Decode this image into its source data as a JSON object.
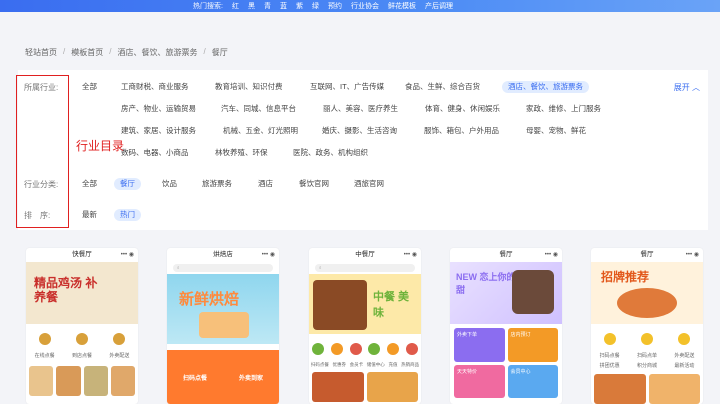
{
  "topbar": {
    "hot_label": "热门搜索:",
    "keywords": [
      "红",
      "黑",
      "青",
      "蓝",
      "紫",
      "绿",
      "预约",
      "行业协会",
      "鲜花模板",
      "产后调理"
    ]
  },
  "breadcrumb": [
    "轻站首页",
    "模板首页",
    "酒店、餐饮、旅游票务",
    "餐厅"
  ],
  "filters": {
    "industry_label": "所属行业:",
    "industry_options": [
      "全部",
      "工商财税、商业服务",
      "教育培训、知识付费",
      "互联网、IT、广告传媒",
      "食品、生鲜、综合百货",
      "酒店、餐饮、旅游票务",
      "房产、物业、运输贸易",
      "汽车、同城、信息平台",
      "丽人、美容、医疗养生",
      "体育、健身、休闲娱乐",
      "家政、维修、上门服务",
      "建筑、家居、设计服务",
      "机械、五金、灯光照明",
      "婚庆、摄影、生活咨询",
      "服饰、箱包、户外用品",
      "母婴、宠物、鲜花",
      "数码、电器、小商品",
      "林牧养殖、环保",
      "医院、政务、机构组织"
    ],
    "expand_label": "展开 ︿",
    "category_label": "行业分类:",
    "category_options": [
      "全部",
      "餐厅",
      "饮品",
      "旅游票务",
      "酒店",
      "餐饮官网",
      "酒旅官网"
    ],
    "sort_label": "排　序:",
    "sort_options": [
      "最新",
      "热门"
    ]
  },
  "annotation": {
    "text": "行业目录",
    "color": "#e02020"
  },
  "cards": [
    {
      "title": "快餐厅",
      "poster_text": "精品鸡汤\n补养餐",
      "icons": [
        "在线点餐",
        "到店点餐",
        "外卖配送"
      ],
      "colors": [
        "#f3e7cf",
        "#c9302c"
      ]
    },
    {
      "title": "烘焙店",
      "poster_text": "新鲜烘焙",
      "icons": [
        "扫码点餐",
        "外卖到家"
      ],
      "colors": [
        "#8fd6ee",
        "#ff8a3d"
      ]
    },
    {
      "title": "中餐厅",
      "poster_text": "中餐 美味",
      "icons": [
        "扫码点餐",
        "优惠券",
        "会员卡",
        "储值中心",
        "充值",
        "热销商品"
      ],
      "colors": [
        "#fde9a8",
        "#6fb33b"
      ]
    },
    {
      "title": "餐厅",
      "poster_text": "NEW 恋上你的甜",
      "icons": [
        "外卖下单",
        "店内预订",
        "天天特价",
        "会员中心"
      ],
      "colors": [
        "#e9e1ff",
        "#8b6df0"
      ]
    },
    {
      "title": "餐厅",
      "poster_text": "招牌推荐",
      "icons": [
        "扫码点餐",
        "扫码点单",
        "外卖配送",
        "拼团优惠",
        "积分商城",
        "最新活动"
      ],
      "colors": [
        "#fff2dc",
        "#f39a26"
      ]
    }
  ],
  "theme": {
    "accent": "#3a6df0",
    "topbar_from": "#3a6df0",
    "topbar_to": "#6aa3f7"
  }
}
